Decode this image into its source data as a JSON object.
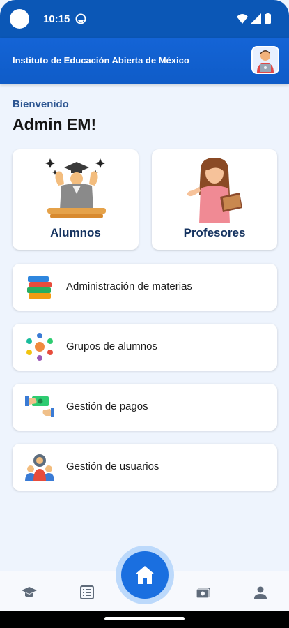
{
  "status_bar": {
    "time": "10:15"
  },
  "app_bar": {
    "title": "Instituto de Educación Abierta de México",
    "avatar_icon": "teacher-avatar-icon"
  },
  "greeting": {
    "welcome": "Bienvenido",
    "name": "Admin EM!"
  },
  "main_cards": [
    {
      "label": "Alumnos",
      "icon": "graduate-student-icon"
    },
    {
      "label": "Profesores",
      "icon": "teacher-icon"
    }
  ],
  "menu_items": [
    {
      "label": "Administración de materias",
      "icon": "books-icon"
    },
    {
      "label": "Grupos de alumnos",
      "icon": "student-groups-icon"
    },
    {
      "label": "Gestión de pagos",
      "icon": "payment-hands-icon"
    },
    {
      "label": "Gestión de usuarios",
      "icon": "user-management-icon"
    }
  ],
  "bottom_nav": {
    "items": [
      "graduation-cap-icon",
      "list-icon",
      "home-icon",
      "payment-card-icon",
      "profile-icon"
    ],
    "active": "home-icon"
  },
  "colors": {
    "primary": "#1565d8",
    "status_bar": "#0b57b6",
    "background": "#eef4fd",
    "title_text": "#14325f"
  }
}
